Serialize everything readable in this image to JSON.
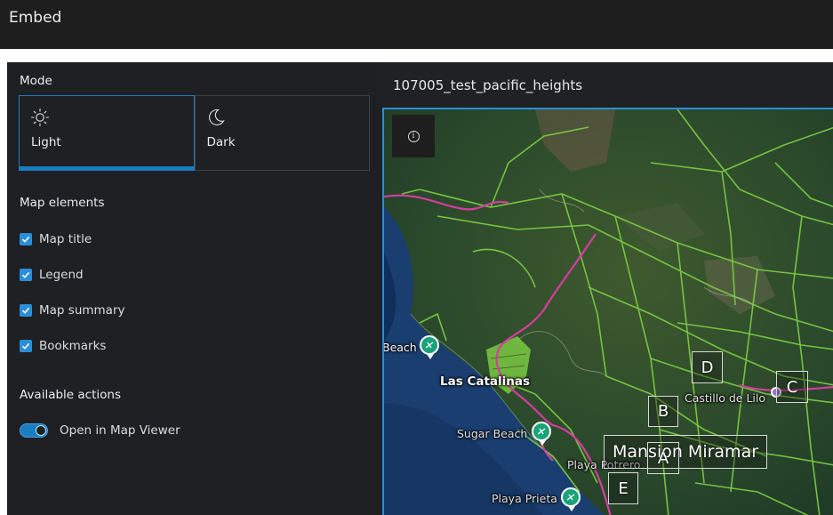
{
  "header": {
    "title": "Embed"
  },
  "mode": {
    "title": "Mode",
    "options": [
      {
        "label": "Light",
        "icon": "sun-icon",
        "selected": true
      },
      {
        "label": "Dark",
        "icon": "moon-icon",
        "selected": false
      }
    ]
  },
  "map_elements": {
    "title": "Map elements",
    "items": [
      {
        "label": "Map title",
        "checked": true
      },
      {
        "label": "Legend",
        "checked": true
      },
      {
        "label": "Map summary",
        "checked": true
      },
      {
        "label": "Bookmarks",
        "checked": true
      }
    ]
  },
  "actions": {
    "title": "Available actions",
    "open_in_map_viewer": {
      "label": "Open in Map Viewer",
      "enabled": true
    }
  },
  "preview": {
    "map_title": "107005_test_pacific_heights",
    "info_icon": "info-icon",
    "labels": {
      "beach_left": "Beach",
      "las_catalinas": "Las Catalinas",
      "sugar_beach": "Sugar Beach",
      "playa_potrero": "Playa Potrero",
      "playa_prieta": "Playa Prieta",
      "castillo_de_lilo": "Castillo de Lilo"
    },
    "bookmarks": {
      "a": "A",
      "b": "B",
      "c": "C",
      "d": "D",
      "e": "E",
      "mansion": "Mansion Miramar"
    }
  },
  "colors": {
    "accent": "#1a7dc1",
    "checkbox": "#2a8fd8",
    "road": "#d63ca0",
    "parcel": "#7ac943",
    "water": "#173a6b"
  }
}
